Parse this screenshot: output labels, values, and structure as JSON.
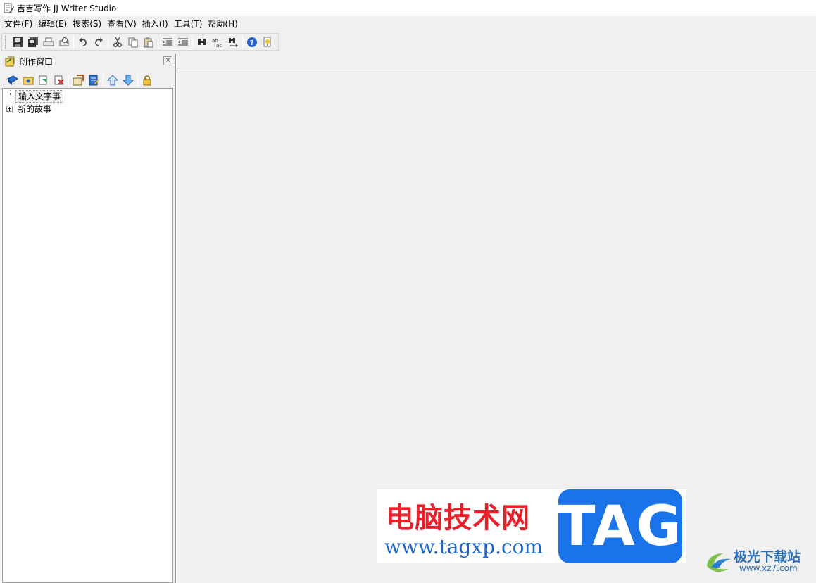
{
  "window": {
    "title": "吉吉写作 JJ Writer Studio"
  },
  "menu": [
    "文件(F)",
    "编辑(E)",
    "搜索(S)",
    "查看(V)",
    "插入(I)",
    "工具(T)",
    "帮助(H)"
  ],
  "toolbar": {
    "buttons": [
      "save-icon",
      "save-all-icon",
      "print-icon",
      "print-preview-icon",
      "undo-icon",
      "redo-icon",
      "cut-icon",
      "copy-icon",
      "paste-icon",
      "indent-icon",
      "outdent-icon",
      "find-icon",
      "replace-icon",
      "find-next-icon",
      "help-icon",
      "tip-icon"
    ]
  },
  "panel": {
    "title": "创作窗口",
    "close_glyph": "×",
    "tree": [
      {
        "label": "输入文字事",
        "type": "leaf",
        "selected": true
      },
      {
        "label": "新的故事",
        "type": "folder",
        "expanded": false
      }
    ]
  },
  "watermark": {
    "brand_cn": "电脑技术网",
    "brand_url": "www.tagxp.com",
    "tag": "TAG",
    "site2_name": "极光下载站",
    "site2_url": "www.xz7.com"
  },
  "colors": {
    "window_bg": "#f0f0f0",
    "tree_bg": "#ffffff",
    "watermark_red": "#e8202a",
    "watermark_blue": "#1a73e8"
  }
}
